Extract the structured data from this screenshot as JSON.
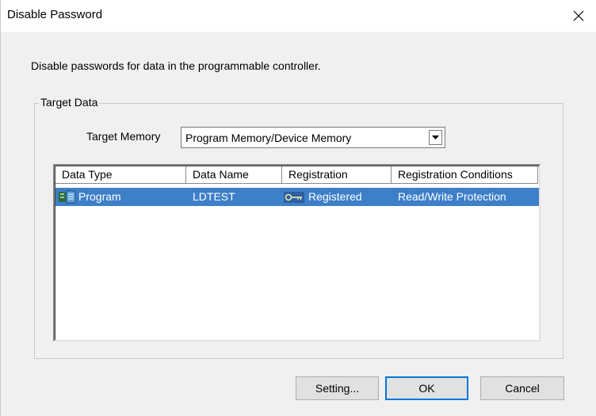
{
  "window": {
    "title": "Disable Password",
    "close_icon": "close-icon"
  },
  "description": "Disable passwords for data in the programmable controller.",
  "target_data": {
    "legend": "Target Data",
    "memory_label": "Target Memory",
    "memory_selected": "Program Memory/Device Memory"
  },
  "list": {
    "columns": [
      "Data Type",
      "Data Name",
      "Registration",
      "Registration Conditions"
    ],
    "rows": [
      {
        "data_type": "Program",
        "data_type_icon": "program-icon",
        "data_name": "LDTEST",
        "registration": "Registered",
        "registration_icon": "key-icon",
        "conditions": "Read/Write Protection",
        "selected": true
      }
    ]
  },
  "buttons": {
    "setting": "Setting...",
    "ok": "OK",
    "cancel": "Cancel"
  },
  "colors": {
    "selection": "#3d7fc8",
    "default_button_border": "#0078d7"
  }
}
